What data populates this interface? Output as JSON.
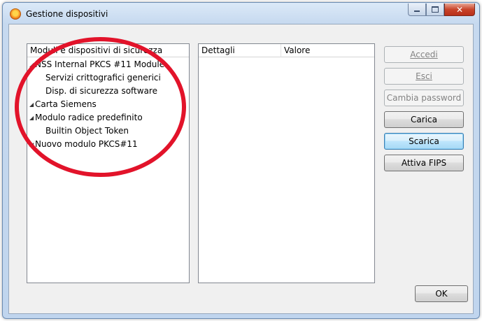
{
  "window": {
    "title": "Gestione dispositivi"
  },
  "tree": {
    "header": "Moduli e dispositivi di sicurezza",
    "items": [
      {
        "label": "NSS Internal PKCS #11 Module",
        "level": 0,
        "expanded": true
      },
      {
        "label": "Servizi crittografici generici",
        "level": 1
      },
      {
        "label": "Disp. di sicurezza software",
        "level": 1
      },
      {
        "label": "Carta Siemens",
        "level": 0,
        "expanded": true
      },
      {
        "label": "Modulo radice predefinito",
        "level": 0,
        "expanded": true
      },
      {
        "label": "Builtin Object Token",
        "level": 1
      },
      {
        "label": "Nuovo modulo PKCS#11",
        "level": 0,
        "expanded": true
      }
    ]
  },
  "details": {
    "col_details": "Dettagli",
    "col_value": "Valore"
  },
  "buttons": {
    "accedi": "Accedi",
    "esci": "Esci",
    "cambia_password": "Cambia password",
    "carica": "Carica",
    "scarica": "Scarica",
    "attiva_fips": "Attiva FIPS",
    "ok": "OK"
  },
  "caption_buttons": {
    "close": "✕"
  },
  "colors": {
    "annotation": "#e2132a",
    "accent": "#3c7fb1"
  }
}
